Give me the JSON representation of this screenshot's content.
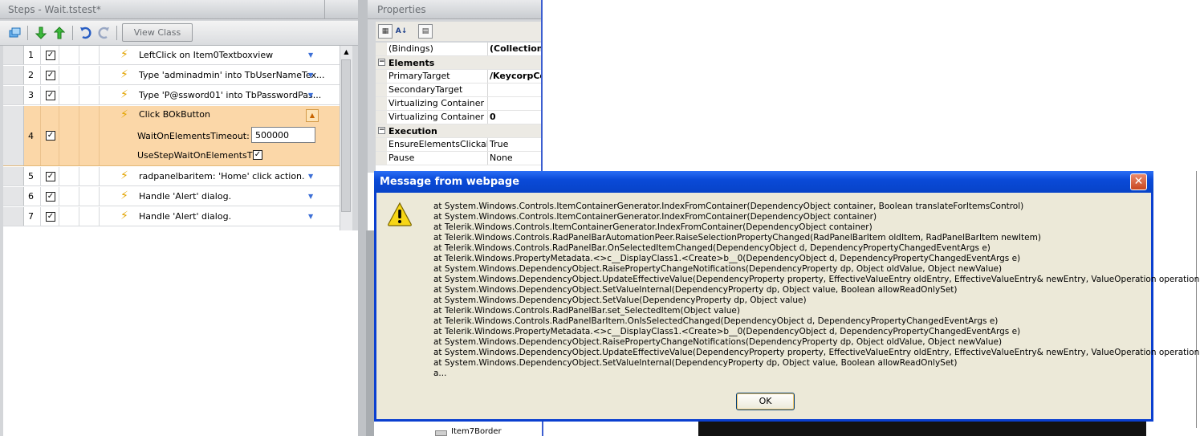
{
  "steps_panel": {
    "title": "Steps - Wait.tstest*",
    "toolbar": {
      "view_class_label": "View Class"
    },
    "rows": [
      {
        "num": "1",
        "text": "LeftClick on Item0Textboxview"
      },
      {
        "num": "2",
        "text": "Type 'adminadmin' into TbUserNameTex..."
      },
      {
        "num": "3",
        "text": "Type 'P@ssword01' into TbPasswordPas..."
      },
      {
        "num": "4",
        "text": "Click BOkButton",
        "wait_timeout_label": "WaitOnElementsTimeout:",
        "wait_timeout_value": "500000",
        "use_step_wait_label": "UseStepWaitOnElementsTi..."
      },
      {
        "num": "5",
        "text": "radpanelbaritem: 'Home' click action."
      },
      {
        "num": "6",
        "text": "Handle 'Alert' dialog."
      },
      {
        "num": "7",
        "text": "Handle 'Alert' dialog."
      }
    ]
  },
  "properties_panel": {
    "title": "Properties",
    "rows": [
      {
        "key": "(Bindings)",
        "value": "(Collection)"
      },
      {
        "category": "Elements"
      },
      {
        "key": "PrimaryTarget",
        "value": "/KeycorpCe"
      },
      {
        "key": "SecondaryTarget",
        "value": ""
      },
      {
        "key": "Virtualizing Container",
        "value": ""
      },
      {
        "key": "Virtualizing Container Off:",
        "value": "0"
      },
      {
        "category": "Execution"
      },
      {
        "key": "EnsureElementsClickable",
        "value": "True"
      },
      {
        "key": "Pause",
        "value": "None"
      }
    ],
    "tree_item": "Item7Border"
  },
  "dialog": {
    "title": "Message from webpage",
    "icon": "warning-icon",
    "lines": [
      "at System.Windows.Controls.ItemContainerGenerator.IndexFromContainer(DependencyObject container, Boolean translateForItemsControl)",
      "at System.Windows.Controls.ItemContainerGenerator.IndexFromContainer(DependencyObject container)",
      "at Telerik.Windows.Controls.ItemContainerGenerator.IndexFromContainer(DependencyObject container)",
      "at Telerik.Windows.Controls.RadPanelBarAutomationPeer.RaiseSelectionPropertyChanged(RadPanelBarItem oldItem, RadPanelBarItem newItem)",
      "at Telerik.Windows.Controls.RadPanelBar.OnSelectedItemChanged(DependencyObject d, DependencyPropertyChangedEventArgs e)",
      "at Telerik.Windows.PropertyMetadata.<>c__DisplayClass1.<Create>b__0(DependencyObject d, DependencyPropertyChangedEventArgs e)",
      "at System.Windows.DependencyObject.RaisePropertyChangeNotifications(DependencyProperty dp, Object oldValue, Object newValue)",
      "at System.Windows.DependencyObject.UpdateEffectiveValue(DependencyProperty property, EffectiveValueEntry oldEntry, EffectiveValueEntry& newEntry, ValueOperation operation)",
      "at System.Windows.DependencyObject.SetValueInternal(DependencyProperty dp, Object value, Boolean allowReadOnlySet)",
      "at System.Windows.DependencyObject.SetValue(DependencyProperty dp, Object value)",
      "at Telerik.Windows.Controls.RadPanelBar.set_SelectedItem(Object value)",
      "at Telerik.Windows.Controls.RadPanelBarItem.OnIsSelectedChanged(DependencyObject d, DependencyPropertyChangedEventArgs e)",
      "at Telerik.Windows.PropertyMetadata.<>c__DisplayClass1.<Create>b__0(DependencyObject d, DependencyPropertyChangedEventArgs e)",
      "at System.Windows.DependencyObject.RaisePropertyChangeNotifications(DependencyProperty dp, Object oldValue, Object newValue)",
      "at System.Windows.DependencyObject.UpdateEffectiveValue(DependencyProperty property, EffectiveValueEntry oldEntry, EffectiveValueEntry& newEntry, ValueOperation operation)",
      "at System.Windows.DependencyObject.SetValueInternal(DependencyProperty dp, Object value, Boolean allowReadOnlySet)",
      "a..."
    ],
    "ok_label": "OK"
  },
  "colors": {
    "selected_row": "#fbd7a8",
    "dialog_title_bar": "#0a4ad8",
    "step_icon": "#e2a400",
    "dropdown_arrow": "#3d6fd6"
  }
}
